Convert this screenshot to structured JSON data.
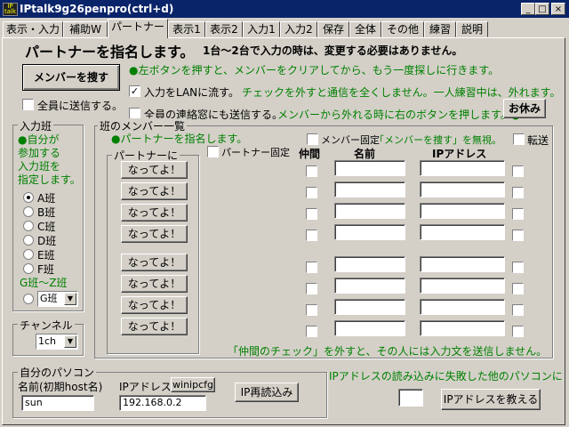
{
  "window": {
    "title": "IPtalk9g26penpro(ctrl+d)",
    "icon_text": "IP talk"
  },
  "window_controls": [
    "_",
    "□",
    "×"
  ],
  "tabs": [
    "表示・入力",
    "補助W",
    "パートナー",
    "表示1",
    "表示2",
    "入力1",
    "入力2",
    "保存",
    "全体",
    "その他",
    "練習",
    "説明"
  ],
  "active_tab": 2,
  "header": {
    "main": "パートナーを指名します。",
    "sub": "1台～2台で入力の時は、変更する必要はありません。"
  },
  "find_members_button": "メンバーを捜す",
  "notes": {
    "left_button": "●左ボタンを押すと、メンバーをクリアしてから、もう一度探しに行きます。",
    "lan": "チェックを外すと通信を全くしません。一人練習中は、外れます。",
    "lunch": "メンバーから外れる時に右のボタンを押します。●"
  },
  "checkboxes": {
    "send_all": {
      "label": "全員に送信する。",
      "checked": false
    },
    "flow_lan": {
      "label": "入力をLANに流す。",
      "checked": true
    },
    "send_all_contacts": {
      "label": "全員の連絡窓にも送信する。",
      "checked": false
    },
    "member_fixed": {
      "label": "メンバー固定",
      "checked": false
    },
    "transfer": {
      "label": "転送",
      "checked": false
    },
    "partner_fixed": {
      "label": "パートナー固定",
      "checked": false
    }
  },
  "member_fixed_note": "「メンバーを捜す」を無視。",
  "rest_button": "お休み",
  "input_team": {
    "label": "入力班",
    "desc": [
      "●自分が",
      "参加する",
      "入力班を",
      "指定します。"
    ],
    "options": [
      "A班",
      "B班",
      "C班",
      "D班",
      "E班",
      "F班"
    ],
    "selected": 0,
    "gz_label": "G班～Z班",
    "gz_value": "G班"
  },
  "channel": {
    "label": "チャンネル",
    "value": "1ch"
  },
  "member_list": {
    "label": "班のメンバー一覧",
    "partner_note": "●パートナーを指名します。",
    "partner_group_label": "パートナーに",
    "partner_buttons": [
      "なってよ！",
      "なってよ！",
      "なってよ！",
      "なってよ！",
      "なってよ！",
      "なってよ！",
      "なってよ！",
      "なってよ！"
    ],
    "col_headers": {
      "nakama": "仲間",
      "name": "名前",
      "ip": "IPアドレス"
    },
    "footer_note": "「仲間のチェック」を外すと、その人には入力文を送信しません。"
  },
  "my_pc": {
    "label": "自分のパソコン",
    "name_label": "名前(初期host名)",
    "ip_label": "IPアドレス",
    "winipcfg_button": "winipcfg",
    "name_value": "sun",
    "ip_value": "192.168.0.2",
    "reload_button": "IP再読込み"
  },
  "ip_fail": {
    "note": "IPアドレスの読み込みに失敗した他のパソコンに",
    "teach_button": "IPアドレスを教える",
    "value": ""
  }
}
